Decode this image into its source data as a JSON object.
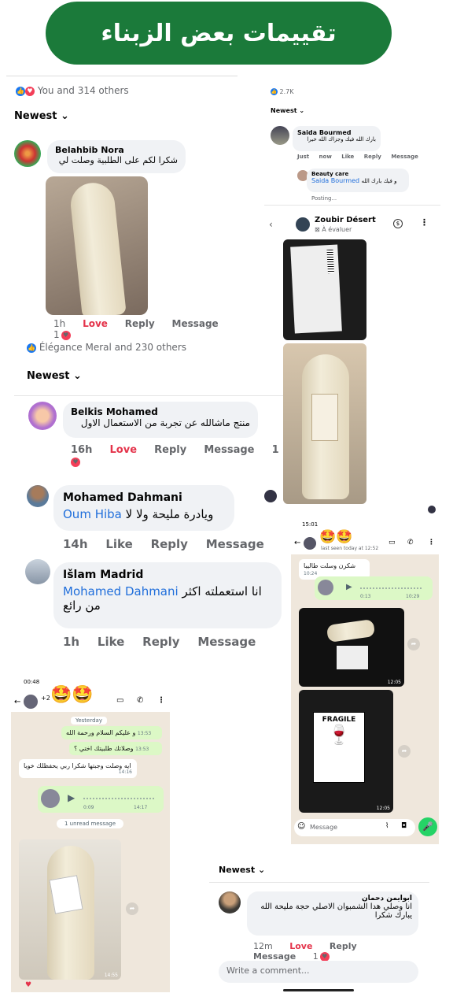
{
  "banner": {
    "title": "تقييمات بعض الزبناء"
  },
  "fb1": {
    "reactions": "You and 314 others",
    "sort": "Newest",
    "comment": {
      "name": "Belahbib Nora",
      "text": "شكرا لكم على الطلبية وصلت لي"
    },
    "actions": {
      "time": "1h",
      "love": "Love",
      "reply": "Reply",
      "message": "Message",
      "count": "1"
    }
  },
  "fb2": {
    "reactions": "Élégance Meral and 230 others",
    "sort": "Newest",
    "c1": {
      "name": "Belkis Mohamed",
      "text": "منتج ماشالله عن تجربة من الاستعمال الاول",
      "time": "16h",
      "love": "Love",
      "reply": "Reply",
      "message": "Message",
      "count": "1"
    },
    "c2": {
      "name": "Mohamed Dahmani",
      "mention": "Oum Hiba",
      "text": "ويادرة مليحة ولا لا",
      "time": "14h",
      "like": "Like",
      "reply": "Reply",
      "message": "Message"
    },
    "c3": {
      "name": "Išlam Madrid",
      "mention": "Mohamed Dahmani",
      "text": "انا استعملته اكثر",
      "text2": "من رائع",
      "time": "1h",
      "like": "Like",
      "reply": "Reply",
      "message": "Message"
    }
  },
  "fb3": {
    "reactions": "2.7K",
    "sort": "Newest",
    "c1": {
      "name": "Saida Bourmed",
      "text": "بارك الله فيك وجزاك الله خيرا",
      "time": "Just now",
      "like": "Like",
      "reply": "Reply",
      "message": "Message"
    },
    "c2": {
      "name": "Beauty care",
      "mention": "Saida Bourmed",
      "text": "و فيك بارك الله"
    },
    "posting": "Posting...",
    "header": {
      "name": "Zoubir Désert",
      "sub": "À évaluer"
    }
  },
  "wa1": {
    "status": "15:01",
    "lastseen": "last seen today at 12:52",
    "msg1": "شكرن وسلت طاليبا",
    "msg1_time": "10:24",
    "voice_dur": "0:13",
    "voice_time": "10:29",
    "photo1_time": "12:05",
    "photo2_time": "12:05",
    "photo2_label": "FRAGILE",
    "input": "Message"
  },
  "wa2": {
    "status": "00:48",
    "contact": "+2",
    "day": "Yesterday",
    "m1": "و عليكم السلام ورحمة الله",
    "m1t": "13:53",
    "m2": "وصلاتك طلبيتك اختي ؟",
    "m2t": "13:53",
    "m3": "ايه وصلت وجبتها شكرا ربي يحفظلك خويا",
    "m3t": "14:16",
    "voice_dur": "0:09",
    "voice_time": "14:17",
    "unread": "1 unread message",
    "photo_time": "14:55"
  },
  "fb4": {
    "sort": "Newest",
    "comment": {
      "name": "ابوايمن دحمان",
      "text": "انا وصلي هدا الشمبوان الاصلي حجة مليحة الله",
      "text2": "يبارك شكرا"
    },
    "actions": {
      "time": "12m",
      "love": "Love",
      "reply": "Reply",
      "message": "Message",
      "count": "1"
    },
    "input": "Write a comment..."
  }
}
